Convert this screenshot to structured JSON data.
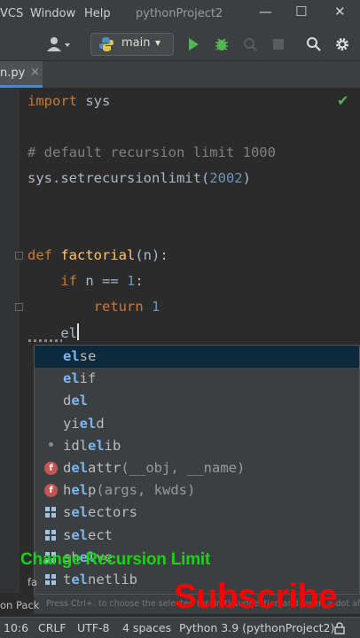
{
  "menu": {
    "vcs": "VCS",
    "window": "Window",
    "help": "Help",
    "project_title": "pythonProject2"
  },
  "window_controls": {
    "minimize": "—",
    "maximize": "☐",
    "close": "✕"
  },
  "toolbar": {
    "branch": "main",
    "chevron": "▾"
  },
  "tab": {
    "label": "n.py",
    "close": "×"
  },
  "code": {
    "line1": {
      "kw": "import",
      "rest": " sys"
    },
    "line2": {
      "comment": "# default recursion limit 1000"
    },
    "line3": {
      "pre": "sys.setrecursionlimit(",
      "num": "2002",
      "post": ")"
    },
    "line4": {
      "kw": "def",
      "sp": " ",
      "fn": "factorial",
      "rest": "(n):"
    },
    "line5": {
      "indent": "    ",
      "kw": "if",
      "pre": " n == ",
      "num": "1",
      "post": ":"
    },
    "line6": {
      "indent": "        ",
      "kw": "return",
      "sp": " ",
      "num": "1"
    },
    "line7": {
      "indent": "    ",
      "typed": "el"
    }
  },
  "completion": [
    {
      "pre": "",
      "hl": "el",
      "post": "se",
      "args": "",
      "icon": "",
      "selected": true
    },
    {
      "pre": "",
      "hl": "el",
      "post": "if",
      "args": "",
      "icon": ""
    },
    {
      "pre": "d",
      "hl": "el",
      "post": "",
      "args": "",
      "icon": ""
    },
    {
      "pre": "yi",
      "hl": "el",
      "post": "d",
      "args": "",
      "icon": ""
    },
    {
      "pre": "idl",
      "hl": "el",
      "post": "ib",
      "args": "",
      "icon": "•"
    },
    {
      "pre": "d",
      "hl": "el",
      "post": "attr",
      "args": "(__obj, __name)",
      "icon": "f"
    },
    {
      "pre": "h",
      "hl": "el",
      "post": "p",
      "args": "(args, kwds)",
      "icon": "f"
    },
    {
      "pre": "s",
      "hl": "el",
      "post": "ectors",
      "args": "",
      "icon": "m"
    },
    {
      "pre": "s",
      "hl": "el",
      "post": "ect",
      "args": "",
      "icon": "m"
    },
    {
      "pre": "sh",
      "hl": "el",
      "post": "ve",
      "args": "",
      "icon": "m"
    },
    {
      "pre": "t",
      "hl": "el",
      "post": "netlib",
      "args": "",
      "icon": "m"
    }
  ],
  "popup_hint": "Press Ctrl+. to choose the selected (or first) suggestion and insert a dot afterwards",
  "side_fragments": {
    "left_mid": "fa",
    "left_bottom": "on Pack"
  },
  "status": {
    "position": "10:6",
    "line_sep": "CRLF",
    "encoding": "UTF-8",
    "indent": "4 spaces",
    "interpreter": "Python 3.9 (pythonProject2)"
  },
  "overlay": {
    "caption": "Change Recursion Limit",
    "subscribe": "Subscribe"
  },
  "colors": {
    "keyword": "#cc7832",
    "number": "#6897bb",
    "comment": "#808080",
    "function": "#ffc66d",
    "match": "#7ab7f0"
  }
}
